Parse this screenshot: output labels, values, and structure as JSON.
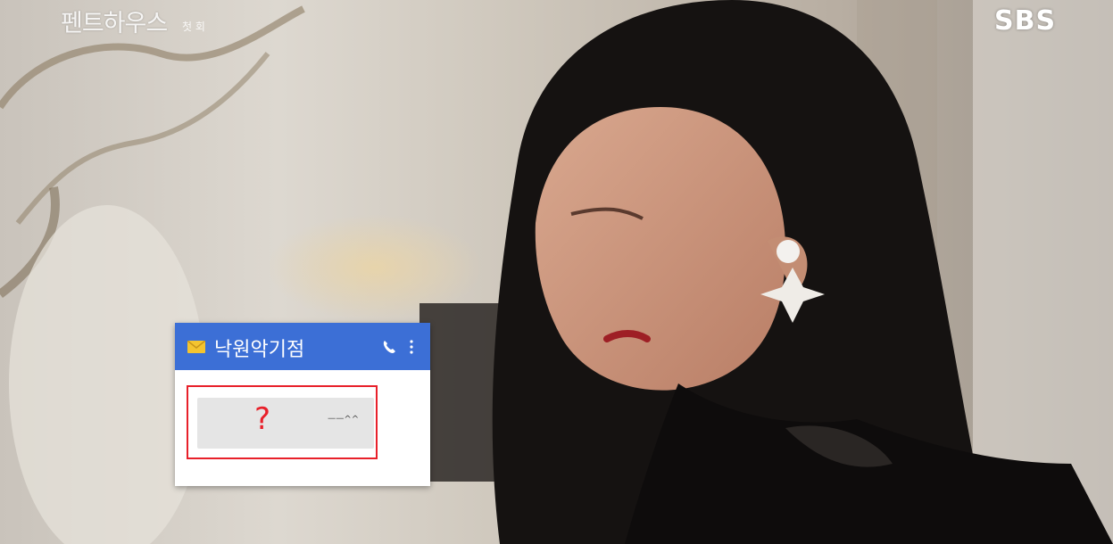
{
  "overlay": {
    "show_title": "펜트하우스",
    "episode": "첫 회",
    "broadcaster": "SBS"
  },
  "sms_notification": {
    "sender": "낙원악기점",
    "message_marker": "?",
    "message_snippet": "ᅳᅳ^^",
    "icons": [
      "envelope-icon",
      "phone-icon",
      "more-icon"
    ],
    "header_color": "#3c6fd6",
    "highlight_color": "#e8202a"
  }
}
